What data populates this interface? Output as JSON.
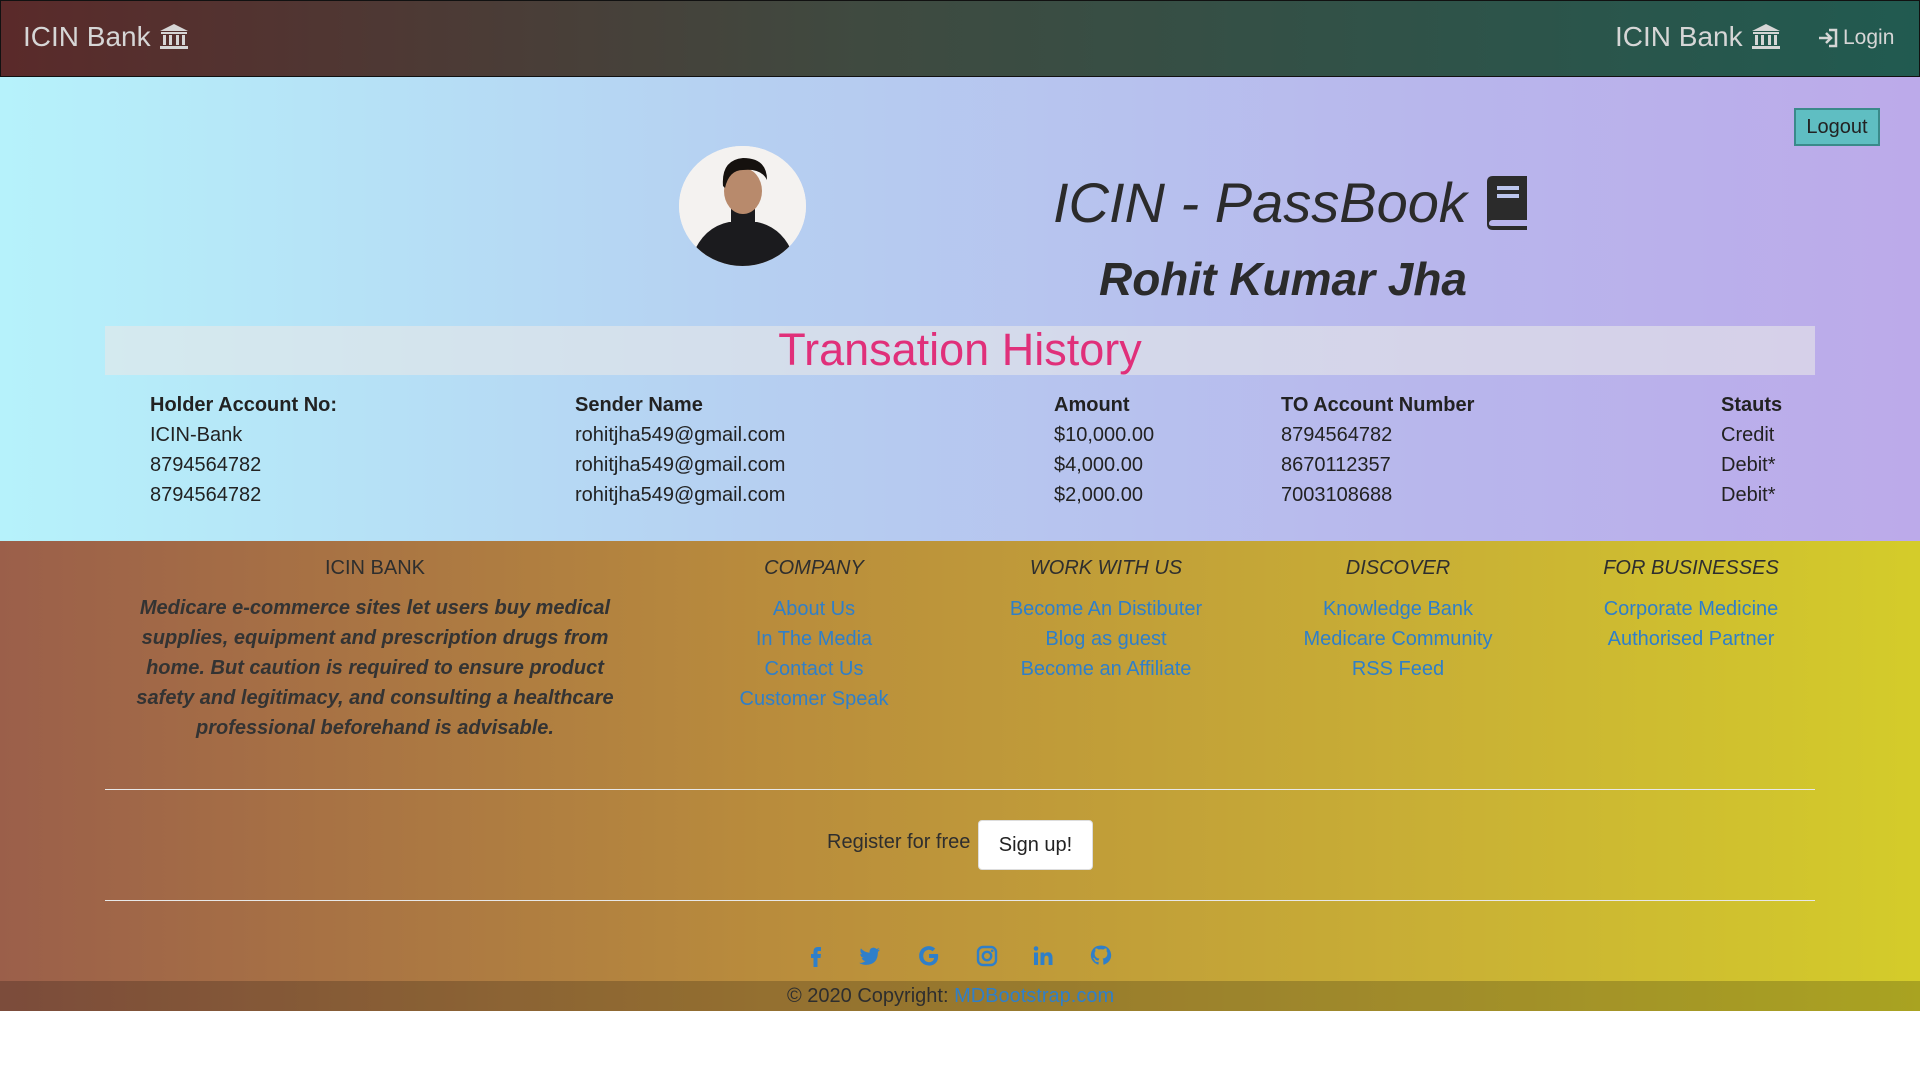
{
  "nav": {
    "brand_left": "ICIN Bank",
    "brand_right": "ICIN Bank",
    "login_label": "Login"
  },
  "hero": {
    "logout_label": "Logout",
    "passbook_title": "ICIN - PassBook",
    "holder_name": "Rohit Kumar Jha",
    "history_title": "Transation History"
  },
  "table": {
    "headers": [
      "Holder Account No:",
      "Sender Name",
      "Amount",
      "TO Account Number",
      "Stauts"
    ],
    "rows": [
      [
        "ICIN-Bank",
        "rohitjha549@gmail.com",
        "$10,000.00",
        "8794564782",
        "Credit"
      ],
      [
        "8794564782",
        "rohitjha549@gmail.com",
        "$4,000.00",
        "8670112357",
        "Debit*"
      ],
      [
        "8794564782",
        "rohitjha549@gmail.com",
        "$2,000.00",
        "7003108688",
        "Debit*"
      ]
    ]
  },
  "footer": {
    "about_heading": "ICIN BANK",
    "about_text": "Medicare e-commerce sites let users buy medical supplies, equipment and prescription drugs from home. But caution is required to ensure product safety and legitimacy, and consulting a healthcare professional beforehand is advisable.",
    "columns": [
      {
        "heading": "COMPANY",
        "links": [
          "About Us",
          "In The Media",
          "Contact Us",
          "Customer Speak"
        ]
      },
      {
        "heading": "WORK WITH US",
        "links": [
          "Become An Distibuter",
          "Blog as guest",
          "Become an Affiliate"
        ]
      },
      {
        "heading": "DISCOVER",
        "links": [
          "Knowledge Bank",
          "Medicare Community",
          "RSS Feed"
        ]
      },
      {
        "heading": "FOR BUSINESSES",
        "links": [
          "Corporate Medicine",
          "Authorised Partner"
        ]
      }
    ],
    "register_text": "Register for free",
    "signup_label": "Sign up!",
    "social_icons": [
      "facebook-icon",
      "twitter-icon",
      "google-icon",
      "instagram-icon",
      "linkedin-icon",
      "github-icon"
    ],
    "copyright_text": "© 2020 Copyright:",
    "copyright_link": "MDBootstrap.com"
  },
  "colors": {
    "accent_link": "#2f7fc9",
    "history_title": "#e0307a",
    "logout_button": "#5fbec2"
  }
}
